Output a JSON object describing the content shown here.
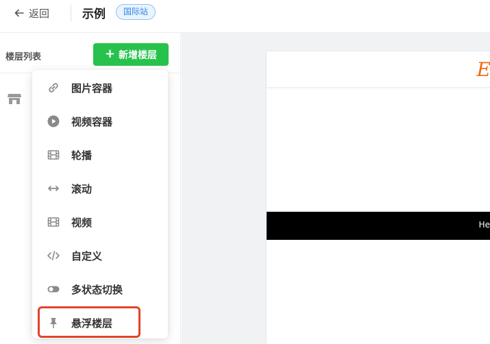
{
  "header": {
    "back_label": "返回",
    "title": "示例",
    "site_badge": "国际站"
  },
  "sidebar": {
    "title": "楼层列表",
    "add_button_label": "新增楼层",
    "add_button_plus": "+",
    "floor_item_label": " "
  },
  "preview": {
    "brand_logo_text": "El",
    "black_bar_text": "He"
  },
  "menu": {
    "items": [
      {
        "label": "图片容器",
        "icon": "link-icon"
      },
      {
        "label": "视频容器",
        "icon": "play-circle-icon"
      },
      {
        "label": "轮播",
        "icon": "film-icon"
      },
      {
        "label": "滚动",
        "icon": "horizontal-arrows-icon"
      },
      {
        "label": "视频",
        "icon": "film-icon"
      },
      {
        "label": "自定义",
        "icon": "code-icon"
      },
      {
        "label": "多状态切换",
        "icon": "toggle-icon"
      },
      {
        "label": "悬浮楼层",
        "icon": "pin-icon"
      }
    ]
  },
  "colors": {
    "primary_green": "#27c24c",
    "badge_blue": "#2e86de",
    "highlight_red": "#e0442a",
    "brand_orange": "#f26a10"
  }
}
